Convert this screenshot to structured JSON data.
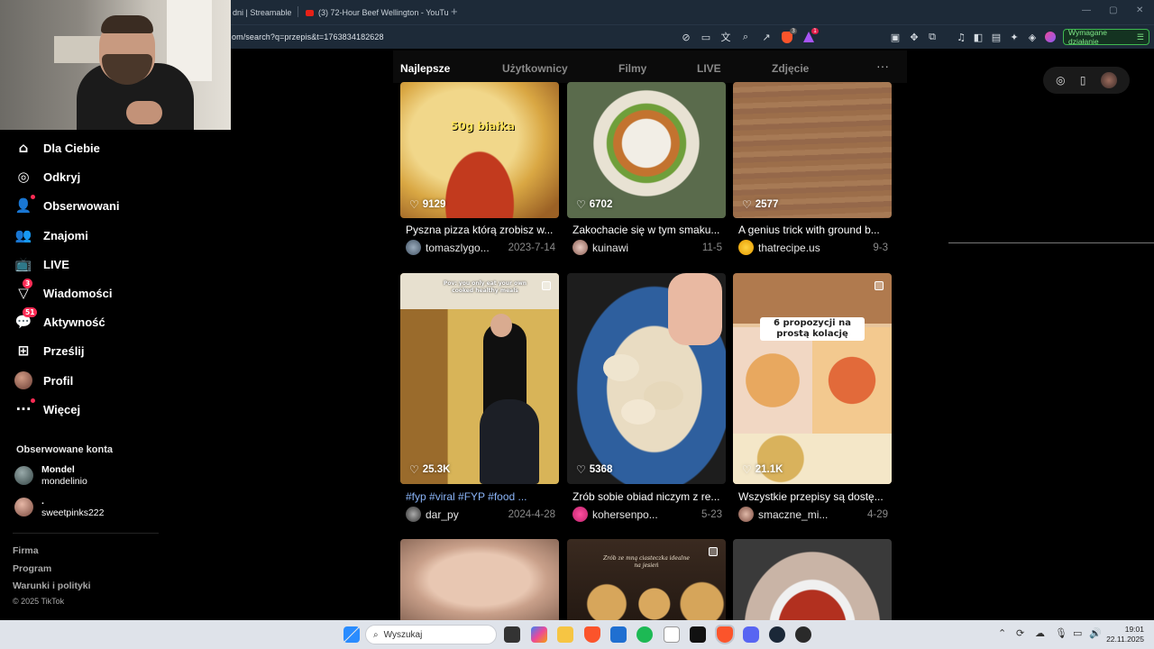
{
  "browser": {
    "tabs": [
      {
        "label": "dni | Streamable"
      },
      {
        "label": "(3) 72-Hour Beef Wellington - YouTu"
      }
    ],
    "new_tab": "+",
    "url": "om/search?q=przepis&t=1763834182628",
    "action_button": "Wymagane działanie",
    "ext_badge_1": "3",
    "ext_badge_2": "1"
  },
  "sidebar": {
    "items": [
      {
        "label": "Dla Ciebie",
        "icon": "home-icon"
      },
      {
        "label": "Odkryj",
        "icon": "compass-icon"
      },
      {
        "label": "Obserwowani",
        "icon": "user-follow-icon"
      },
      {
        "label": "Znajomi",
        "icon": "friends-icon"
      },
      {
        "label": "LIVE",
        "icon": "live-icon"
      },
      {
        "label": "Wiadomości",
        "icon": "send-icon",
        "badge": "3"
      },
      {
        "label": "Aktywność",
        "icon": "activity-icon",
        "badge": "51"
      },
      {
        "label": "Prześlij",
        "icon": "upload-icon"
      },
      {
        "label": "Profil",
        "icon": "avatar"
      },
      {
        "label": "Więcej",
        "icon": "more-icon"
      }
    ],
    "following_title": "Obserwowane konta",
    "following": [
      {
        "name": "Mondel",
        "handle": "mondelinio"
      },
      {
        "name": ".",
        "handle": "sweetpinks222"
      }
    ],
    "footer": [
      "Firma",
      "Program",
      "Warunki i polityki"
    ],
    "copyright": "© 2025 TikTok"
  },
  "search_tabs": {
    "items": [
      "Najlepsze",
      "Użytkownicy",
      "Filmy",
      "LIVE",
      "Zdjęcie"
    ],
    "active": "Najlepsze",
    "more": "···"
  },
  "videos": [
    {
      "likes": "9129",
      "caption": "Pyszna pizza którą zrobisz w...",
      "user": "tomaszlygo...",
      "date": "2023-7-14",
      "overlay": "50g białka"
    },
    {
      "likes": "6702",
      "caption": "Zakochacie się w tym smaku...",
      "user": "kuinawi",
      "date": "11-5"
    },
    {
      "likes": "2577",
      "caption": "A genius trick with ground b...",
      "user": "thatrecipe.us",
      "date": "9-3"
    },
    {
      "likes": "25.3K",
      "caption": "#fyp #viral #FYP #food ...",
      "user": "dar_py",
      "date": "2024-4-28",
      "overlay": "Pov: you only eat your own cooked healthy meals"
    },
    {
      "likes": "5368",
      "caption": "Zrób sobie obiad niczym z re...",
      "user": "kohersenpo...",
      "date": "5-23"
    },
    {
      "likes": "21.1K",
      "caption": "Wszystkie przepisy są dostę...",
      "user": "smaczne_mi...",
      "date": "4-29",
      "overlay": "6 propozycji na prostą kolację"
    },
    {
      "overlay": "Zrób ze mną ciasteczka idealne na jesień"
    }
  ],
  "taskbar": {
    "search_placeholder": "Wyszukaj",
    "time": "19:01",
    "date": "22.11.2025"
  },
  "colors": {
    "accent": "#fe2c55",
    "background": "#000000",
    "action_green": "#3fb950"
  }
}
